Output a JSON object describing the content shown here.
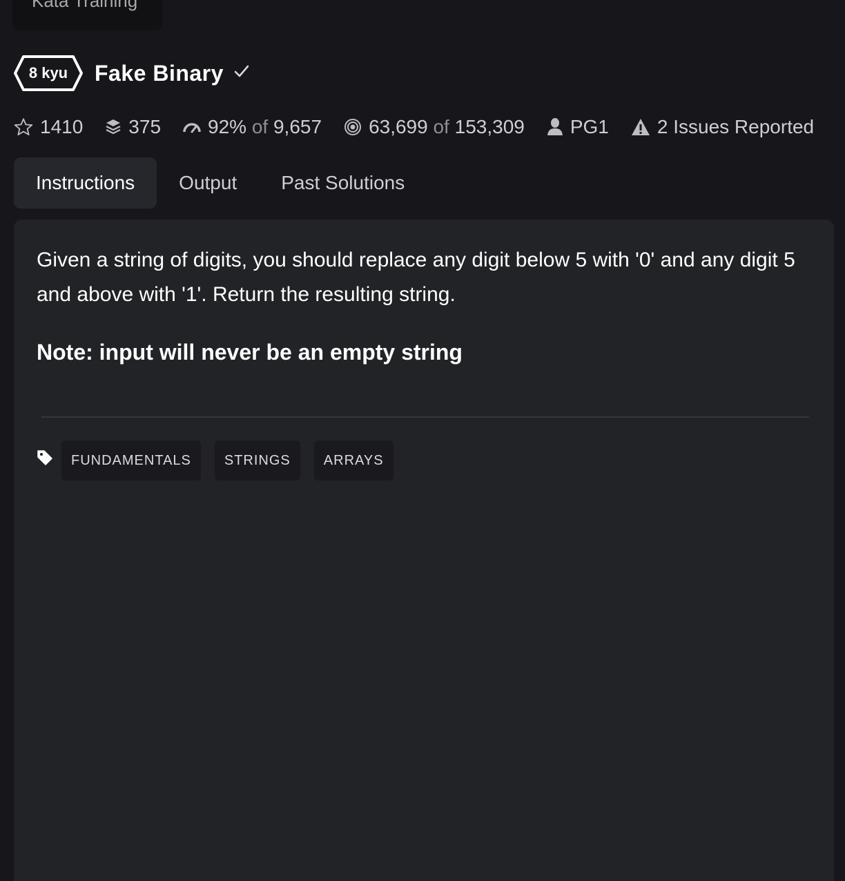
{
  "top_chip": {
    "label": "Kata Training"
  },
  "kata": {
    "rank": "8 kyu",
    "title": "Fake Binary"
  },
  "stats": {
    "stars": "1410",
    "collections": "375",
    "satisfaction": "92%",
    "satisfaction_of": "of",
    "satisfaction_votes": "9,657",
    "completed": "63,699",
    "completed_of": "of",
    "attempted": "153,309",
    "author": "PG1",
    "issues": "2 Issues Reported"
  },
  "tabs": [
    {
      "label": "Instructions",
      "active": true
    },
    {
      "label": "Output",
      "active": false
    },
    {
      "label": "Past Solutions",
      "active": false
    }
  ],
  "instructions": {
    "description": "Given a string of digits, you should replace any digit below 5 with '0' and any digit 5 and above with '1'. Return the resulting string.",
    "note": "Note: input will never be an empty string"
  },
  "tags": [
    "FUNDAMENTALS",
    "STRINGS",
    "ARRAYS"
  ],
  "icons": {
    "stars": "star-icon",
    "collections": "layers-icon",
    "satisfaction": "gauge-icon",
    "completed": "target-icon",
    "author": "user-icon",
    "issues": "warning-icon",
    "completed_check": "check-icon",
    "tags": "tag-icon"
  },
  "colors": {
    "background": "#17171b",
    "panel": "#222327",
    "active_tab": "#26272c",
    "text": "#ffffff",
    "muted_text": "#cfcfd3"
  }
}
